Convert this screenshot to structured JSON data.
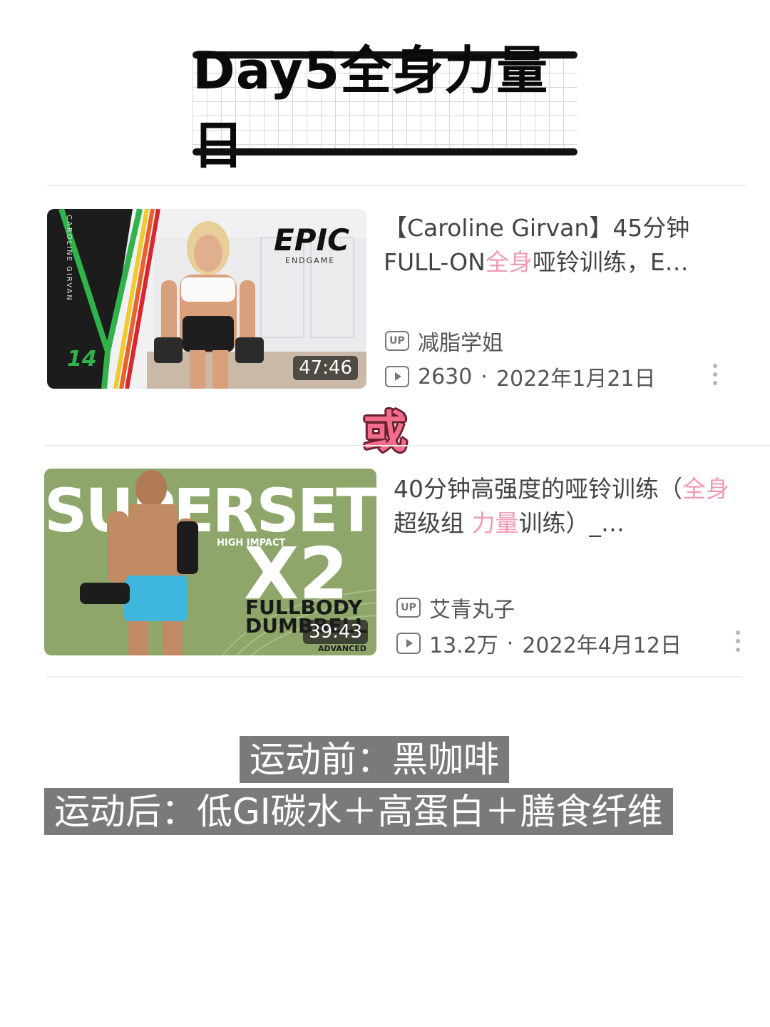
{
  "page_title": "Day5全身力量日",
  "separator_text": "或",
  "videos": [
    {
      "title_parts": [
        {
          "text": "【Caroline Girvan】45分钟 FULL-ON",
          "hl": false
        },
        {
          "text": "全身",
          "hl": true
        },
        {
          "text": "哑铃训练，E…",
          "hl": false
        }
      ],
      "uploader": "减脂学姐",
      "views": "2630",
      "date": "2022年1月21日",
      "duration": "47:46",
      "thumb_text": {
        "brand": "EPIC",
        "sub": "ENDGAME",
        "side": "CAROLINE GIRVAN",
        "num": "14"
      }
    },
    {
      "title_parts": [
        {
          "text": "40分钟高强度的哑铃训练（",
          "hl": false
        },
        {
          "text": "全身",
          "hl": true
        },
        {
          "text": " 超级组 ",
          "hl": false
        },
        {
          "text": "力量",
          "hl": true
        },
        {
          "text": "训练）_…",
          "hl": false
        }
      ],
      "uploader": "艾青丸子",
      "views": "13.2万",
      "date": "2022年4月12日",
      "duration": "39:43",
      "thumb_text": {
        "big": "SUPERSET",
        "x2": "X2",
        "impact": "HIGH IMPACT",
        "line1": "FULLBODY",
        "line2": "DUMBBELL",
        "level": "ADVANCED"
      }
    }
  ],
  "labels": {
    "up": "UP",
    "dot": "·"
  },
  "notes": {
    "before": "运动前：黑咖啡",
    "after": "运动后：低GI碳水＋高蛋白＋膳食纤维"
  },
  "colors": {
    "highlight": "#f19bb3",
    "note_bg": "#7a7a7a",
    "or_fill": "#f26d8d"
  }
}
